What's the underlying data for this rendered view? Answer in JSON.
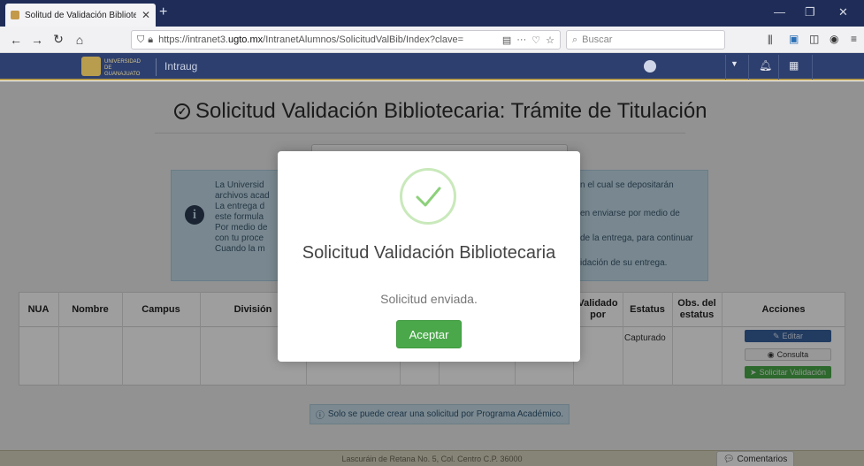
{
  "browser": {
    "tab_title": "Solitud de Validación Bibliotec",
    "tab_close": "✕",
    "new_tab": "+",
    "url_prefix": "https://intranet3.",
    "url_domain": "ugto.mx",
    "url_path": "/IntranetAlumnos/SolicitudValBib/Index?clave=",
    "search_placeholder": "Buscar",
    "menu_dots": "···"
  },
  "app": {
    "logo_text": "UNIVERSIDAD DE GUANAJUATO",
    "app_name": "Intraug"
  },
  "page": {
    "title": "Solicitud Validación Bibliotecaria: Trámite de Titulación",
    "info_lines_left": [
      "La Universid",
      "archivos acad",
      "La entrega d",
      "este formula",
      "Por medio de",
      "con tu proce",
      "Cuando la m"
    ],
    "info_lines_right": [
      "n el cual se depositarán",
      "en enviarse por medio de",
      "de la entrega, para continuar",
      "idación de su entrega."
    ],
    "table": {
      "headers": [
        "NUA",
        "Nombre",
        "Campus",
        "División",
        "Validado por",
        "Estatus",
        "Obs. del estatus",
        "Acciones"
      ],
      "status": "Capturado",
      "actions": {
        "edit": "Editar",
        "consult": "Consulta",
        "request": "Solicitar Validación"
      }
    },
    "note": "Solo se puede crear una solicitud por Programa Académico.",
    "footer": "Lascuráin de Retana No. 5, Col. Centro C.P. 36000",
    "comments": "Comentarios"
  },
  "modal": {
    "title": "Solicitud Validación Bibliotecaria",
    "subtitle": "Solicitud enviada.",
    "ok_label": "Aceptar"
  },
  "colors": {
    "header_blue": "#2d3f6e",
    "gold": "#b89d4e",
    "success_green": "#4aa84a",
    "info_blue": "#c3dce8"
  }
}
